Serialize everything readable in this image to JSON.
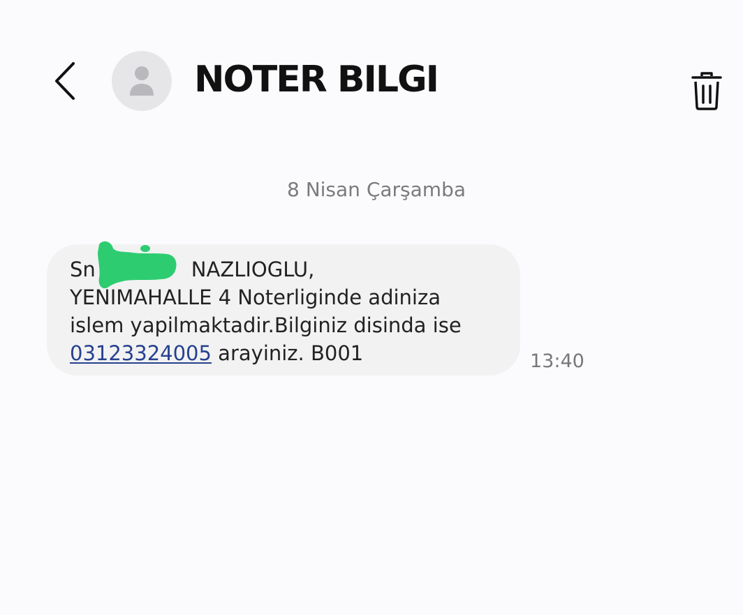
{
  "header": {
    "title": "NOTER BILGI",
    "back_icon": "chevron-left-icon",
    "avatar_icon": "person-icon",
    "delete_icon": "trash-icon"
  },
  "conversation": {
    "date_separator": "8 Nisan Çarşamba",
    "messages": [
      {
        "lines": {
          "line1_start": "Sn",
          "line1_end": "NAZLIOGLU,",
          "line2": "YENIMAHALLE 4 Noterliginde adiniza",
          "line3": "islem yapilmaktadir.Bilginiz disinda ise",
          "phone": "03123324005",
          "line4_rest": " arayiniz. B001"
        },
        "time": "13:40"
      }
    ]
  },
  "colors": {
    "background": "#fbfbfe",
    "bubble": "#f2f2f2",
    "link": "#26418f",
    "redaction": "#2ecc71"
  }
}
